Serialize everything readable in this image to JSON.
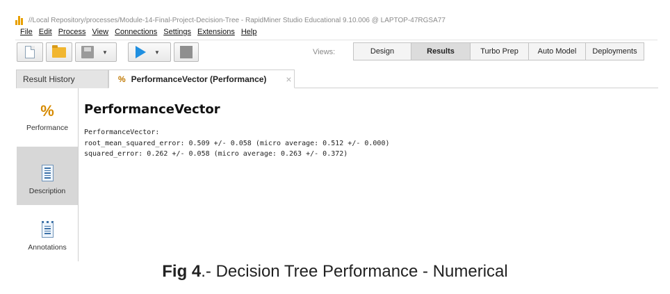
{
  "window": {
    "title": "//Local Repository/processes/Module-14-Final-Project-Decision-Tree - RapidMiner Studio Educational 9.10.006 @ LAPTOP-47RGSA77"
  },
  "menu": [
    "File",
    "Edit",
    "Process",
    "View",
    "Connections",
    "Settings",
    "Extensions",
    "Help"
  ],
  "toolbar": {
    "icons": [
      "new-process-icon",
      "open-folder-icon",
      "save-icon",
      "run-icon",
      "stop-icon"
    ]
  },
  "views": {
    "label": "Views:",
    "tabs": [
      "Design",
      "Results",
      "Turbo Prep",
      "Auto Model",
      "Deployments"
    ],
    "active": "Results"
  },
  "result_tabs": {
    "history": "Result History",
    "performance": "PerformanceVector (Performance)",
    "close_glyph": "×"
  },
  "sidebar": {
    "items": [
      {
        "label": "Performance",
        "icon": "percent-icon",
        "selected": false
      },
      {
        "label": "Description",
        "icon": "document-icon",
        "selected": true
      },
      {
        "label": "Annotations",
        "icon": "notepad-icon",
        "selected": false
      }
    ]
  },
  "content": {
    "title": "PerformanceVector",
    "lines": [
      "PerformanceVector:",
      "root_mean_squared_error: 0.509 +/- 0.058 (micro average: 0.512 +/- 0.000)",
      "squared_error: 0.262 +/- 0.058 (micro average: 0.263 +/- 0.372)"
    ]
  },
  "caption": {
    "bold": "Fig 4",
    "rest": ".- Decision Tree Performance - Numerical"
  },
  "colors": {
    "accent_orange": "#d68a00",
    "run_blue": "#1f8fe0"
  }
}
